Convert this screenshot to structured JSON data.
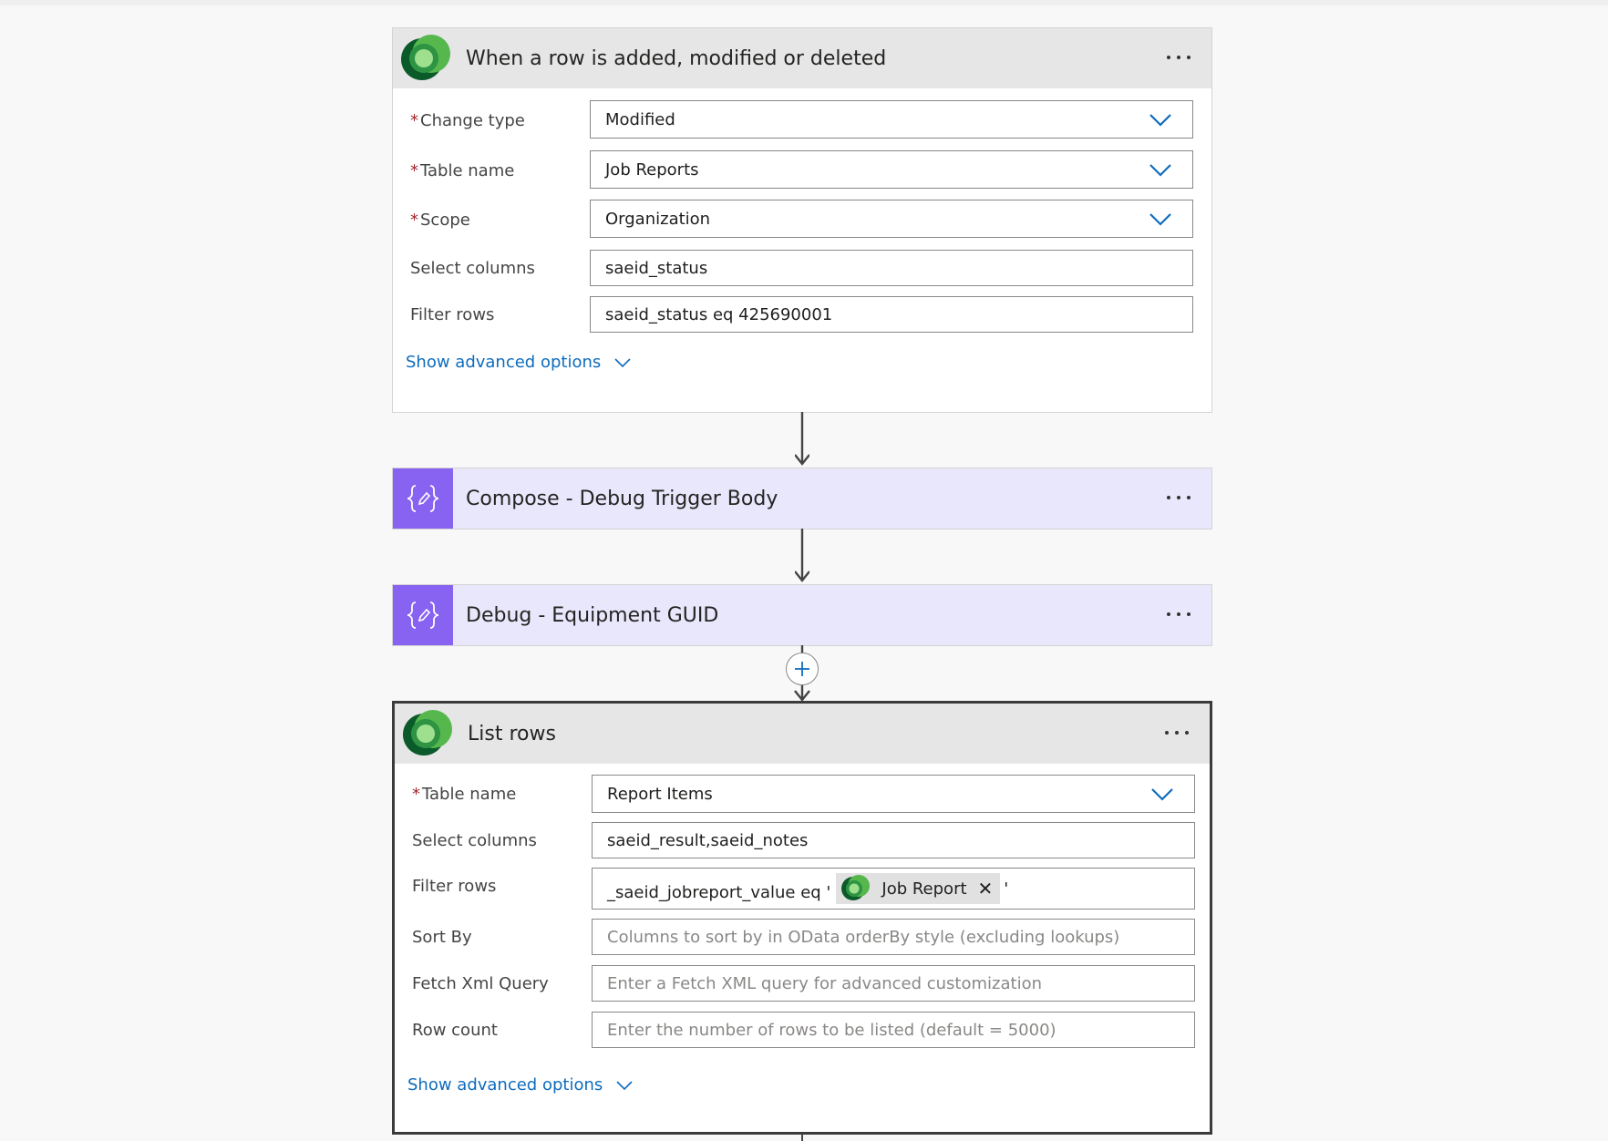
{
  "colors": {
    "canvas": "#f8f8f8",
    "header_gray": "#e6e6e6",
    "action_bg": "#e9e7fb",
    "action_icon": "#8862f0",
    "link_blue": "#0f6cbd",
    "required_red": "#a4262c",
    "dataverse_green": "#2e9443"
  },
  "trigger": {
    "icon": "dataverse-logo-icon",
    "title": "When a row is added, modified or deleted",
    "fields": {
      "change_type": {
        "label": "Change type",
        "value": "Modified",
        "required": "*"
      },
      "table_name": {
        "label": "Table name",
        "value": "Job Reports",
        "required": "*"
      },
      "scope": {
        "label": "Scope",
        "value": "Organization",
        "required": "*"
      },
      "select_columns": {
        "label": "Select columns",
        "value": "saeid_status"
      },
      "filter_rows": {
        "label": "Filter rows",
        "value": "saeid_status eq 425690001"
      }
    },
    "advanced_link": "Show advanced options"
  },
  "actions": [
    {
      "icon": "compose-icon",
      "title": "Compose - Debug Trigger Body"
    },
    {
      "icon": "compose-icon",
      "title": "Debug - Equipment GUID"
    }
  ],
  "list_rows": {
    "icon": "dataverse-logo-icon",
    "title": "List rows",
    "fields": {
      "table_name": {
        "label": "Table name",
        "value": "Report Items",
        "required": "*"
      },
      "select_columns": {
        "label": "Select columns",
        "value": "saeid_result,saeid_notes"
      },
      "filter_rows": {
        "label": "Filter rows",
        "prefix": "_saeid_jobreport_value eq '",
        "token": "Job Report",
        "suffix": "'"
      },
      "sort_by": {
        "label": "Sort By",
        "placeholder": "Columns to sort by in OData orderBy style (excluding lookups)"
      },
      "fetch_xml": {
        "label": "Fetch Xml Query",
        "placeholder": "Enter a Fetch XML query for advanced customization"
      },
      "row_count": {
        "label": "Row count",
        "placeholder": "Enter the number of rows to be listed (default = 5000)"
      }
    },
    "advanced_link": "Show advanced options"
  }
}
